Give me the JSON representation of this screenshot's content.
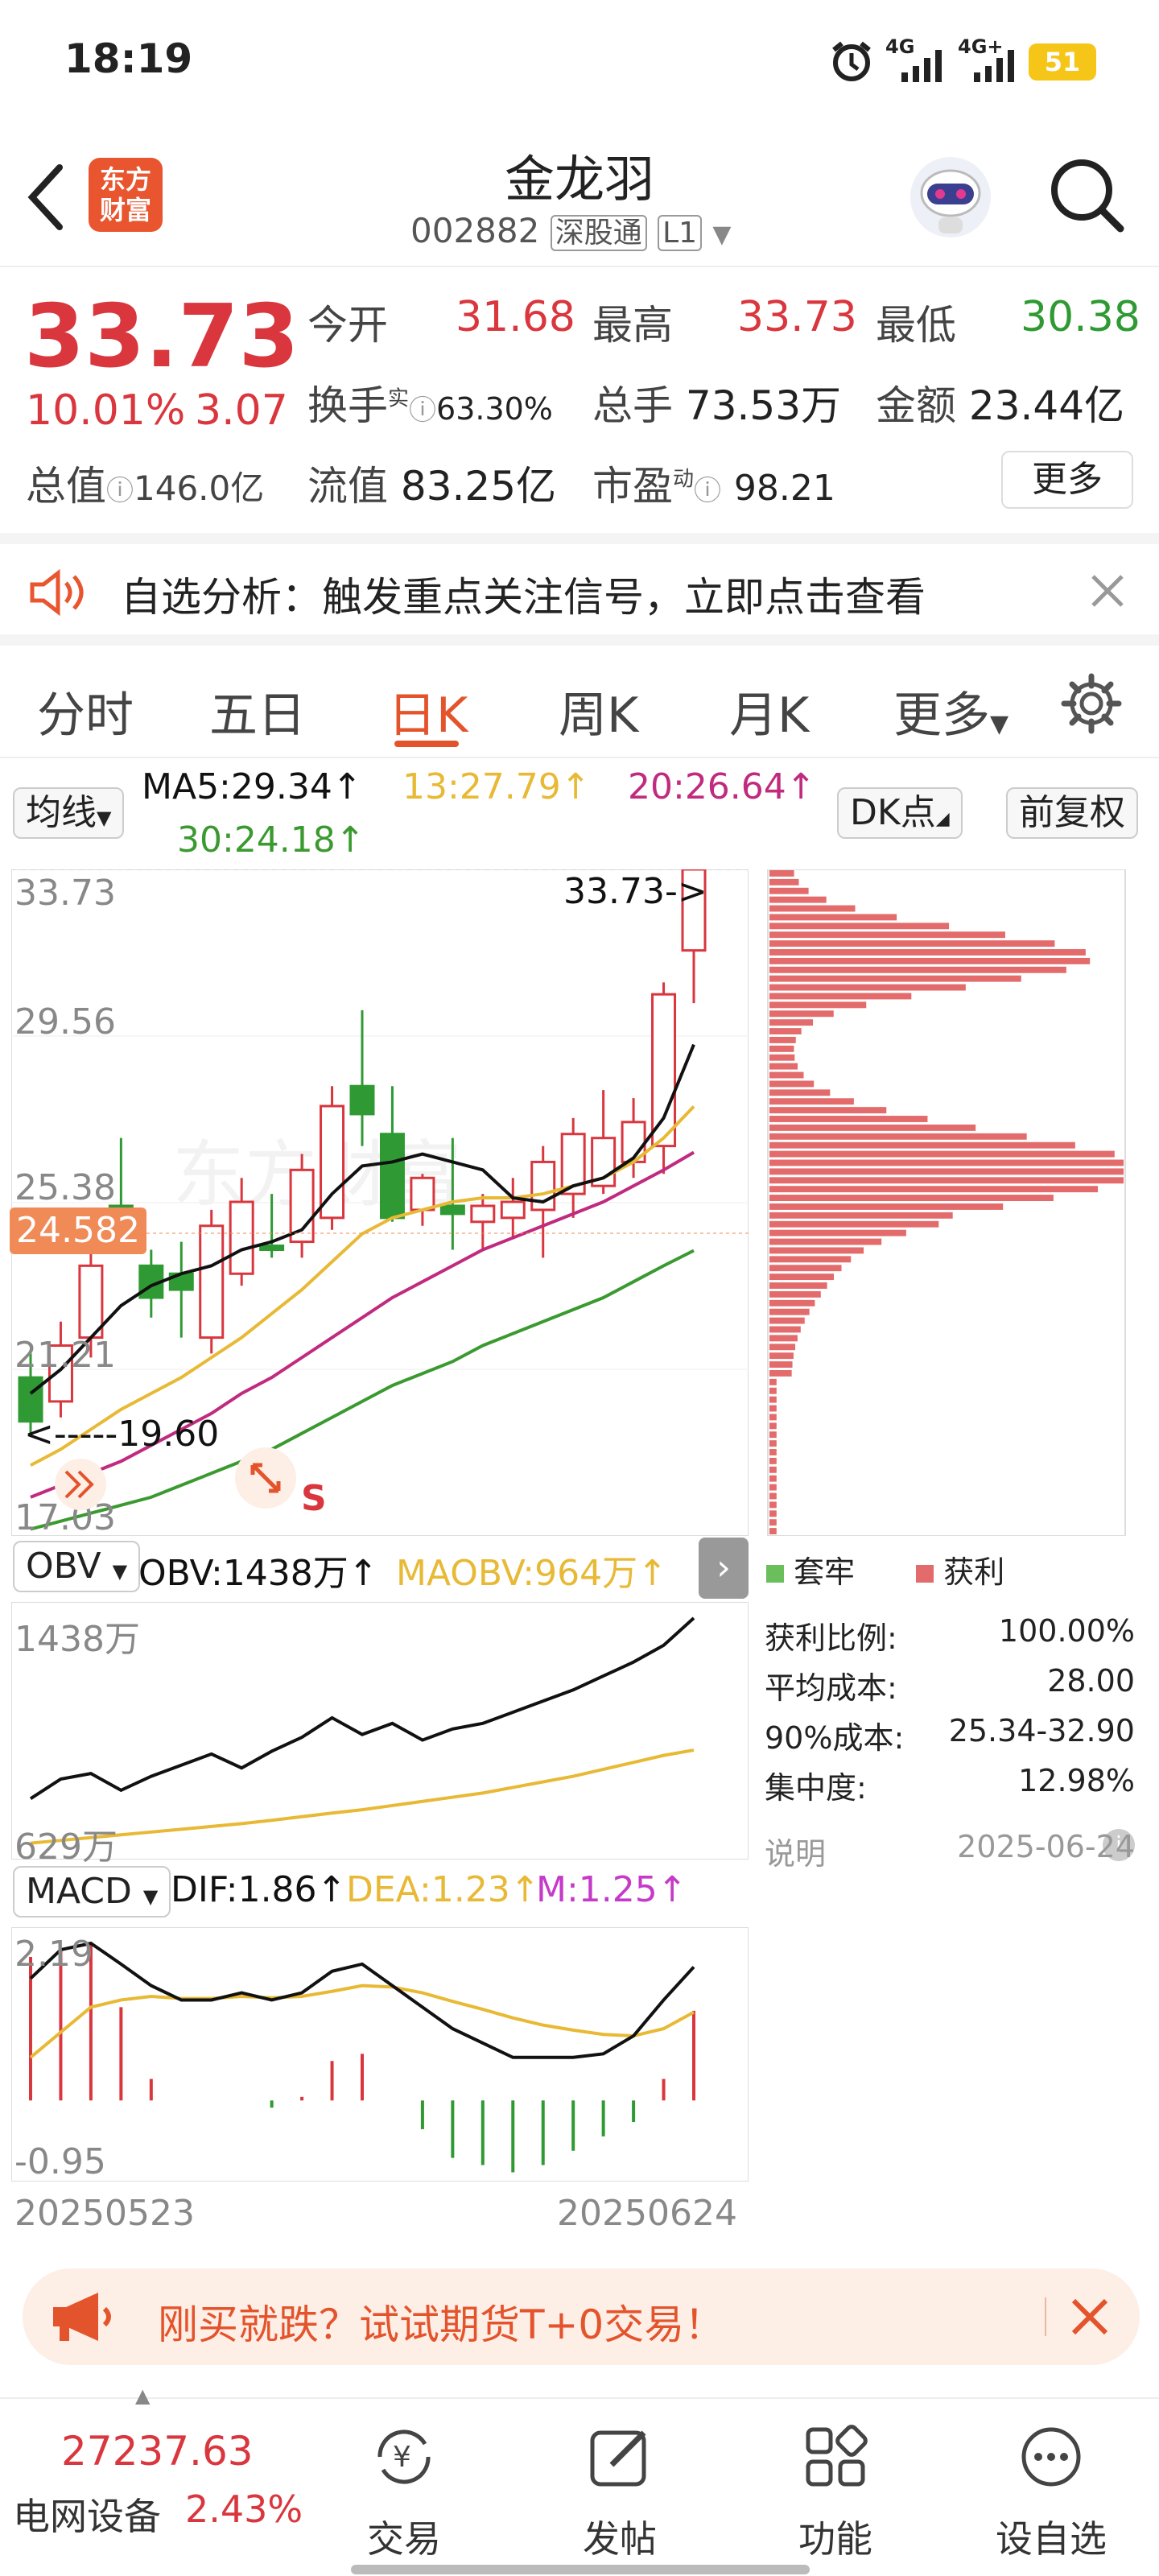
{
  "status": {
    "time": "18:19",
    "net1": "4G",
    "net2": "4G+",
    "battery": "51"
  },
  "header": {
    "title": "金龙羽",
    "code": "002882",
    "exchange": "深股通",
    "level": "L1",
    "logo_line1": "东方",
    "logo_line2": "财富"
  },
  "quote": {
    "price": "33.73",
    "change_pct": "10.01%",
    "change": "3.07",
    "open_label": "今开",
    "open": "31.68",
    "high_label": "最高",
    "high": "33.73",
    "low_label": "最低",
    "low": "30.38",
    "turnover_label": "换手",
    "turnover_sup": "实",
    "turnover": "63.30%",
    "volume_label": "总手",
    "volume": "73.53万",
    "amount_label": "金额",
    "amount": "23.44亿",
    "mktcap_label": "总值",
    "mktcap": "146.0亿",
    "float_label": "流值",
    "float": "83.25亿",
    "pe_label": "市盈",
    "pe_sup": "动",
    "pe": "98.21",
    "more": "更多"
  },
  "notice": {
    "text": "自选分析：触发重点关注信号，立即点击查看"
  },
  "tabs": [
    "分时",
    "五日",
    "日K",
    "周K",
    "月K",
    "更多"
  ],
  "ma": {
    "selector": "均线",
    "ma5": "MA5:29.34",
    "ma13": "13:27.79",
    "ma20": "20:26.64",
    "ma30": "30:24.18",
    "dk": "DK点",
    "adjust": "前复权"
  },
  "main_chart": {
    "y_labels": [
      "33.73",
      "29.56",
      "25.38",
      "21.21",
      "17.03"
    ],
    "current_price": "24.582",
    "max_marker": "33.73->",
    "min_marker": "<-----19.60",
    "s_marker": "S",
    "watermark": "东方财富"
  },
  "obv": {
    "selector": "OBV",
    "obv": "OBV:1438万",
    "maobv": "MAOBV:964万",
    "y_top": "1438万",
    "y_bottom": "629万"
  },
  "macd": {
    "selector": "MACD",
    "dif": "DIF:1.86",
    "dea": "DEA:1.23",
    "m": "M:1.25",
    "y_top": "2.19",
    "y_bottom": "-0.95"
  },
  "dates": {
    "start": "20250523",
    "end": "20250624"
  },
  "chip_stats": {
    "legend_trapped": "套牢",
    "legend_profit": "获利",
    "rows": [
      {
        "label": "获利比例:",
        "value": "100.00%"
      },
      {
        "label": "平均成本:",
        "value": "28.00"
      },
      {
        "label": "90%成本:",
        "value": "25.34-32.90"
      },
      {
        "label": "集中度:",
        "value": "12.98%"
      }
    ],
    "note": "说明",
    "date": "2025-06-24"
  },
  "banner": {
    "text": "刚买就跌？试试期货T+0交易！"
  },
  "bottom": {
    "index_value": "27237.63",
    "index_name": "电网设备",
    "index_change": "2.43%",
    "nav": [
      "交易",
      "发帖",
      "功能",
      "设自选"
    ]
  },
  "colors": {
    "up": "#d9363e",
    "down": "#2f9a33",
    "ma5": "#111111",
    "ma13": "#e8b935",
    "ma20": "#c02a7f",
    "ma30": "#3a9a30",
    "accent": "#e4542c"
  },
  "chart_data": {
    "type": "candlestick",
    "candles": [
      {
        "o": 21.0,
        "h": 21.6,
        "l": 19.6,
        "c": 19.9
      },
      {
        "o": 20.4,
        "h": 22.4,
        "l": 20.0,
        "c": 21.8
      },
      {
        "o": 22.0,
        "h": 24.3,
        "l": 21.5,
        "c": 23.8
      },
      {
        "o": 25.3,
        "h": 27.0,
        "l": 24.4,
        "c": 24.8
      },
      {
        "o": 23.8,
        "h": 24.2,
        "l": 22.5,
        "c": 23.0
      },
      {
        "o": 23.6,
        "h": 24.4,
        "l": 22.0,
        "c": 23.2
      },
      {
        "o": 22.0,
        "h": 25.2,
        "l": 21.6,
        "c": 24.8
      },
      {
        "o": 23.6,
        "h": 26.0,
        "l": 23.3,
        "c": 25.4
      },
      {
        "o": 24.3,
        "h": 25.6,
        "l": 24.0,
        "c": 24.2
      },
      {
        "o": 24.4,
        "h": 26.6,
        "l": 24.0,
        "c": 26.2
      },
      {
        "o": 25.0,
        "h": 28.3,
        "l": 24.7,
        "c": 27.8
      },
      {
        "o": 28.3,
        "h": 30.2,
        "l": 26.8,
        "c": 27.6
      },
      {
        "o": 27.1,
        "h": 28.3,
        "l": 24.9,
        "c": 25.0
      },
      {
        "o": 25.2,
        "h": 26.1,
        "l": 24.8,
        "c": 26.0
      },
      {
        "o": 25.3,
        "h": 27.0,
        "l": 24.2,
        "c": 25.1
      },
      {
        "o": 24.9,
        "h": 25.6,
        "l": 24.2,
        "c": 25.3
      },
      {
        "o": 25.0,
        "h": 26.0,
        "l": 24.5,
        "c": 25.4
      },
      {
        "o": 25.2,
        "h": 26.8,
        "l": 24.0,
        "c": 26.4
      },
      {
        "o": 25.6,
        "h": 27.5,
        "l": 25.0,
        "c": 27.1
      },
      {
        "o": 25.8,
        "h": 28.2,
        "l": 25.6,
        "c": 27.0
      },
      {
        "o": 26.4,
        "h": 28.0,
        "l": 26.0,
        "c": 27.4
      },
      {
        "o": 26.8,
        "h": 30.9,
        "l": 26.1,
        "c": 30.6
      },
      {
        "o": 31.7,
        "h": 33.73,
        "l": 30.38,
        "c": 33.73
      }
    ],
    "ma5": [
      20.6,
      21.2,
      22.0,
      22.8,
      23.3,
      23.6,
      23.8,
      24.2,
      24.4,
      24.7,
      25.6,
      26.3,
      26.4,
      26.6,
      26.4,
      26.2,
      25.5,
      25.4,
      25.8,
      26.0,
      26.5,
      27.5,
      29.34
    ],
    "ma13": [
      18.8,
      19.2,
      19.7,
      20.2,
      20.6,
      21.0,
      21.5,
      22.0,
      22.6,
      23.2,
      23.9,
      24.6,
      25.0,
      25.2,
      25.4,
      25.5,
      25.5,
      25.6,
      25.8,
      26.0,
      26.4,
      27.0,
      27.79
    ],
    "ma20": [
      18.0,
      18.3,
      18.6,
      18.9,
      19.3,
      19.7,
      20.1,
      20.6,
      21.0,
      21.5,
      22.0,
      22.5,
      23.0,
      23.4,
      23.8,
      24.2,
      24.5,
      24.8,
      25.1,
      25.4,
      25.8,
      26.2,
      26.64
    ],
    "ma30": [
      17.2,
      17.4,
      17.6,
      17.8,
      18.0,
      18.3,
      18.6,
      18.9,
      19.2,
      19.6,
      20.0,
      20.4,
      20.8,
      21.1,
      21.4,
      21.8,
      22.1,
      22.4,
      22.7,
      23.0,
      23.4,
      23.8,
      24.18
    ],
    "ylim": [
      17.03,
      33.73
    ],
    "obv": [
      790,
      860,
      880,
      820,
      870,
      910,
      950,
      900,
      960,
      1010,
      1080,
      1020,
      1060,
      1000,
      1040,
      1060,
      1100,
      1140,
      1180,
      1230,
      1280,
      1340,
      1438
    ],
    "maobv": [
      630,
      640,
      650,
      660,
      670,
      680,
      690,
      700,
      712,
      725,
      738,
      750,
      765,
      780,
      795,
      810,
      830,
      850,
      870,
      895,
      920,
      945,
      964
    ],
    "obv_ylim": [
      629,
      1438
    ],
    "dif": [
      1.7,
      2.1,
      2.19,
      1.9,
      1.6,
      1.4,
      1.4,
      1.5,
      1.4,
      1.5,
      1.8,
      1.9,
      1.6,
      1.3,
      1.0,
      0.8,
      0.6,
      0.6,
      0.6,
      0.65,
      0.9,
      1.4,
      1.86
    ],
    "dea": [
      0.6,
      0.95,
      1.3,
      1.4,
      1.45,
      1.42,
      1.42,
      1.45,
      1.43,
      1.45,
      1.52,
      1.6,
      1.58,
      1.5,
      1.38,
      1.27,
      1.15,
      1.05,
      0.98,
      0.92,
      0.9,
      1.0,
      1.23
    ],
    "macd_hist": [
      2.0,
      2.1,
      2.2,
      1.3,
      0.3,
      0.0,
      0.0,
      0.0,
      -0.1,
      0.05,
      0.55,
      0.65,
      0.0,
      -0.4,
      -0.8,
      -0.9,
      -1.0,
      -0.9,
      -0.7,
      -0.5,
      -0.3,
      0.3,
      1.25
    ],
    "macd_ylim": [
      -0.95,
      2.19
    ]
  }
}
